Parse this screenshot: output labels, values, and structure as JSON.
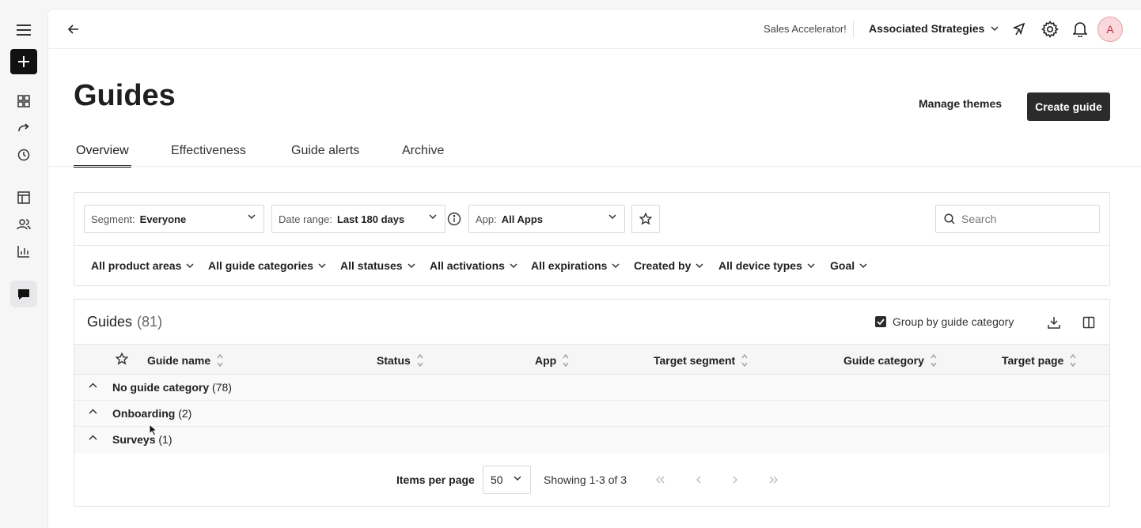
{
  "topbar": {
    "app_name": "Sales Accelerator!",
    "account": "Associated Strategies",
    "avatar_initial": "A"
  },
  "page": {
    "title": "Guides",
    "manage_themes": "Manage themes",
    "create_guide": "Create guide"
  },
  "tabs": [
    {
      "label": "Overview",
      "active": true
    },
    {
      "label": "Effectiveness",
      "active": false
    },
    {
      "label": "Guide alerts",
      "active": false
    },
    {
      "label": "Archive",
      "active": false
    }
  ],
  "filters": {
    "segment": {
      "label": "Segment:",
      "value": "Everyone"
    },
    "date_range": {
      "label": "Date range:",
      "value": "Last 180 days"
    },
    "app": {
      "label": "App:",
      "value": "All Apps"
    },
    "search_placeholder": "Search",
    "secondary": [
      "All product areas",
      "All guide categories",
      "All statuses",
      "All activations",
      "All expirations",
      "Created by",
      "All device types",
      "Goal"
    ]
  },
  "table": {
    "title": "Guides",
    "count": "(81)",
    "group_by_label": "Group by guide category",
    "group_by_checked": true,
    "columns": [
      "Guide name",
      "Status",
      "App",
      "Target segment",
      "Guide category",
      "Target page"
    ],
    "groups": [
      {
        "name": "No guide category",
        "count": "(78)"
      },
      {
        "name": "Onboarding",
        "count": "(2)"
      },
      {
        "name": "Surveys",
        "count": "(1)"
      }
    ],
    "pagination": {
      "items_per_page_label": "Items per page",
      "items_per_page": "50",
      "showing": "Showing 1-3 of 3"
    }
  },
  "colors": {
    "primary_button": "#2b2b2b",
    "avatar_bg": "#f9d9dc",
    "avatar_text": "#c0313f"
  }
}
